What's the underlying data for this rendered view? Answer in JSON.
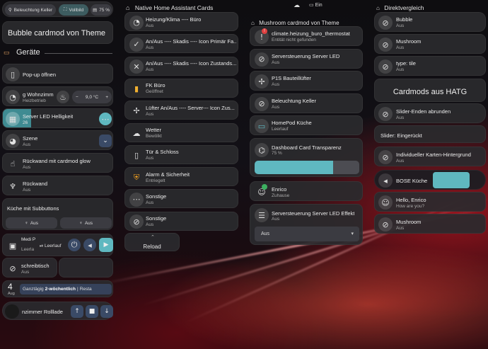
{
  "colors": {
    "accent": "#5fb8c0",
    "badge_red": "#e04040",
    "badge_green": "#3cb060"
  },
  "bubble": {
    "top_buttons": [
      {
        "label": "Beleuchtung Keller",
        "icon": "lightbulb-icon"
      },
      {
        "label": "Vollbild",
        "icon": "fullscreen-icon"
      },
      {
        "label": "75 %",
        "icon": "volume-icon"
      }
    ],
    "title": "Bubble cardmod von Theme",
    "section_label": "Geräte",
    "popup_label": "Pop-up öffnen",
    "climate": {
      "name": "g Wohnzimm",
      "state": "Heizbetrieb",
      "temp": "9,0 °C",
      "minus": "−",
      "plus": "+"
    },
    "led": {
      "name": "Server LED Helligkeit",
      "value": "26",
      "progress": 0.26
    },
    "scene": {
      "name": "Szene",
      "state": "Aus"
    },
    "glow": {
      "name": "Rückwand mit cardmod glow",
      "state": "Aus"
    },
    "back": {
      "name": "Rückwand",
      "state": "Aus"
    },
    "sub_title": "Küche mit Subbuttons",
    "sub_buttons": [
      "Aus",
      "Aus"
    ],
    "media": {
      "name": "Medi Playe",
      "state": "Leerla",
      "sub": "Leerlauf"
    },
    "desk": {
      "name": "schreibtisch",
      "state": "Aus"
    },
    "calendar": {
      "day": "4",
      "month": "Aug",
      "chip1": "Ganztägig",
      "chip2": "2-wöchentlich",
      "chip3": "Resta"
    },
    "shutter": {
      "name": "nzimmer Rolllade"
    }
  },
  "native": {
    "header": "Native Home Assistant Cards",
    "tiles": [
      {
        "name": "Heizung/Klima ---- Büro",
        "state": "Aus",
        "icon": "thermostat-icon"
      },
      {
        "name": "An/Aus ---- Skadis ---- Icon Primär Fa...",
        "state": "Aus",
        "icon": "check-circle-icon"
      },
      {
        "name": "An/Aus ---- Skadis ---- Icon Zustands...",
        "state": "Aus",
        "icon": "close-circle-icon"
      },
      {
        "name": "FK Büro",
        "state": "Geöffnet",
        "icon": "door-icon"
      },
      {
        "name": "Lüfter An/Aus ---- Server--- Icon Zus...",
        "state": "Aus",
        "icon": "fan-icon"
      },
      {
        "name": "Wetter",
        "state": "Bewölkt",
        "icon": "cloud-icon"
      },
      {
        "name": "Tür & Schloss",
        "state": "Aus",
        "icon": "door-lock-icon"
      },
      {
        "name": "Alarm & Sicherheit",
        "state": "Entriegelt",
        "icon": "shield-icon"
      },
      {
        "name": "Sonstige",
        "state": "Aus",
        "icon": "dots-icon"
      },
      {
        "name": "Sonstige",
        "state": "Aus",
        "icon": "bulb-off-icon"
      }
    ],
    "reload_label": "Reload"
  },
  "mushroom": {
    "top_chips": [
      {
        "icon": "cloud-icon"
      },
      {
        "icon": "monitor-icon",
        "label": "Ein"
      }
    ],
    "header": "Mushroom cardmod von Theme",
    "tiles": [
      {
        "name": "climate.heizung_buro_thermostat",
        "state": "Entität nicht gefunden",
        "icon": "alert-icon"
      },
      {
        "name": "Serversteuerung Server LED",
        "state": "Aus",
        "icon": "led-off-icon"
      },
      {
        "name": "P1S Bauteillüfter",
        "state": "Aus",
        "icon": "fan-icon"
      },
      {
        "name": "Beleuchtung Keller",
        "state": "Aus",
        "icon": "bulb-off-icon"
      },
      {
        "name": "HomePod Küche",
        "state": "Leerlauf",
        "icon": "cast-icon"
      }
    ],
    "transparency": {
      "name": "Dashboard Card Transparenz",
      "state": "75 %",
      "progress": 0.75
    },
    "person": {
      "name": "Enrico",
      "state": "Zuhause"
    },
    "effect": {
      "name": "Serversteuerung Server LED Effekt",
      "state": "Aus",
      "select_value": "Aus"
    }
  },
  "compare": {
    "header": "Direktvergleich",
    "tiles": [
      {
        "name": "Bubble",
        "state": "Aus",
        "icon": "bulb-off-icon"
      },
      {
        "name": "Mushroom",
        "state": "Aus",
        "icon": "bulb-off-icon"
      },
      {
        "name": "type: tile",
        "state": "Aus",
        "icon": "bulb-off-icon"
      }
    ],
    "hatg_title": "Cardmods aus HATG",
    "slider_round": {
      "name": "Slider-Enden abrunden",
      "state": "Aus"
    },
    "slider_inset": "Slider: Eingerückt",
    "individual": {
      "name": "Individueller Karten-Hintergrund",
      "state": "Aus"
    },
    "bose": {
      "name": "BOSE Küche"
    },
    "hello": {
      "name": "Hello, Enrico",
      "state": "How are you?"
    },
    "mushroom2": {
      "name": "Mushroom",
      "state": "Aus"
    }
  }
}
